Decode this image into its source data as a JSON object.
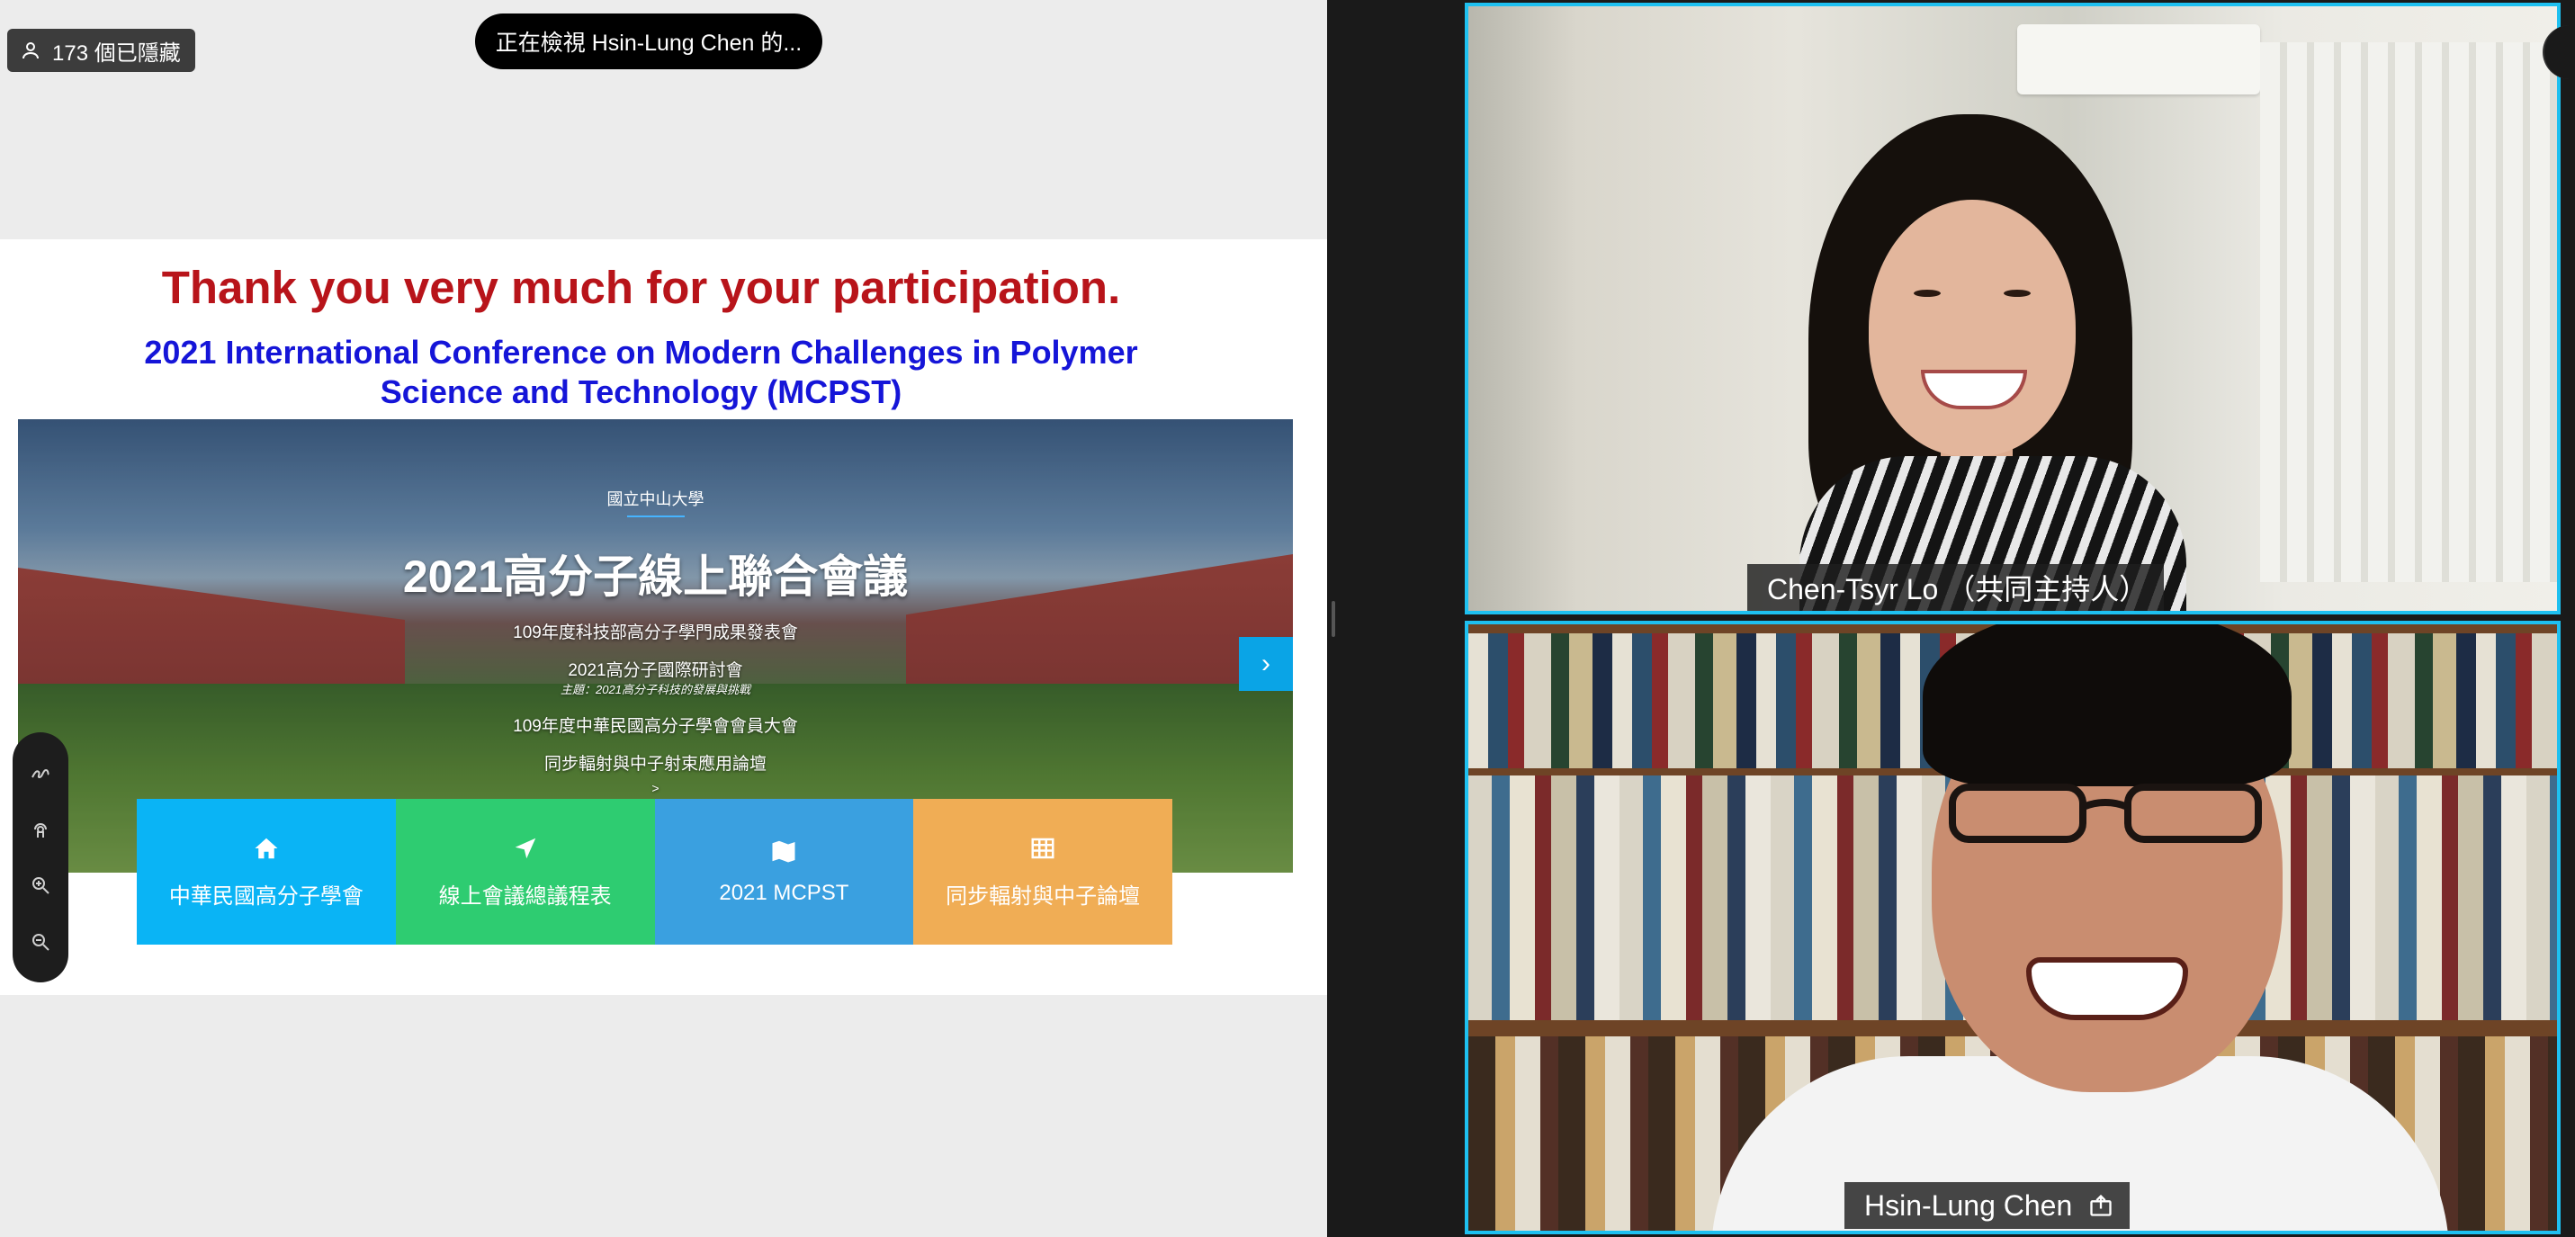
{
  "meeting": {
    "hidden_participants": "173 個已隱藏",
    "viewing_banner": "正在檢視 Hsin-Lung Chen 的..."
  },
  "slide": {
    "title": "Thank you very much for your participation.",
    "subtitle": "2021 International Conference on Modern Challenges in Polymer Science and Technology  (MCPST)"
  },
  "website": {
    "university": "國立中山大學",
    "heading": "2021高分子線上聯合會議",
    "lines": [
      "109年度科技部高分子學門成果發表會",
      "2021高分子國際研討會",
      "主題：2021高分子科技的發展與挑戰",
      "109年度中華民國高分子學會會員大會",
      "同步輻射與中子射束應用論壇"
    ],
    "next_arrow": "›",
    "small_arrow": ">",
    "buttons": [
      {
        "label": "中華民國高分子學會",
        "icon": "home-icon",
        "color": "#0ab4f5"
      },
      {
        "label": "線上會議總議程表",
        "icon": "location-arrow-icon",
        "color": "#2ecc71"
      },
      {
        "label": "2021 MCPST",
        "icon": "map-icon",
        "color": "#3aa0e0"
      },
      {
        "label": "同步輻射與中子論壇",
        "icon": "table-icon",
        "color": "#f0ad55"
      }
    ]
  },
  "annotation_toolbar": [
    "draw-icon",
    "touch-icon",
    "zoom-in-icon",
    "zoom-out-icon"
  ],
  "participants": [
    {
      "name": "Chen-Tsyr Lo （共同主持人）"
    },
    {
      "name": "Hsin-Lung Chen"
    }
  ],
  "colors": {
    "active_speaker_border": "#1ec0f0",
    "slide_title": "#b8141a",
    "slide_subtitle": "#1515d8"
  }
}
